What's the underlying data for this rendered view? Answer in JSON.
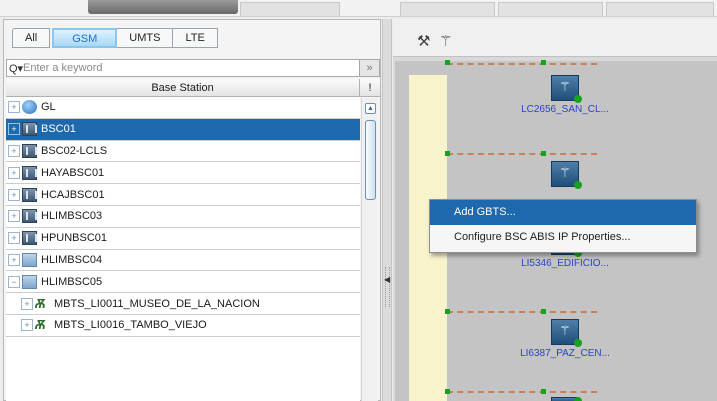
{
  "tabs": [
    {
      "label": "All",
      "active": false
    },
    {
      "label": "GSM",
      "active": true
    },
    {
      "label": "UMTS",
      "active": false
    },
    {
      "label": "LTE",
      "active": false
    }
  ],
  "search": {
    "placeholder": "Enter a keyword",
    "icon": "magnifier-dropdown-icon",
    "collapse_label": "»"
  },
  "table": {
    "header_base_station": "Base Station",
    "header_flag": "!",
    "rows": [
      {
        "label": "GL",
        "icon": "globe-icon",
        "selected": false,
        "child": false
      },
      {
        "label": "BSC01",
        "icon": "bsc-icon",
        "selected": true,
        "child": false
      },
      {
        "label": "BSC02-LCLS",
        "icon": "bsc-icon",
        "selected": false,
        "child": false
      },
      {
        "label": "HAYABSC01",
        "icon": "bsc-icon",
        "selected": false,
        "child": false
      },
      {
        "label": "HCAJBSC01",
        "icon": "bsc-icon",
        "selected": false,
        "child": false
      },
      {
        "label": "HLIMBSC03",
        "icon": "bsc-icon",
        "selected": false,
        "child": false
      },
      {
        "label": "HPUNBSC01",
        "icon": "bsc-icon",
        "selected": false,
        "child": false
      },
      {
        "label": "HLIMBSC04",
        "icon": "bsc-icon",
        "selected": false,
        "child": false
      },
      {
        "label": "HLIMBSC05",
        "icon": "bsc-light-icon",
        "selected": false,
        "child": false
      },
      {
        "label": "MBTS_LI0011_MUSEO_DE_LA_NACION",
        "icon": "mbts-icon",
        "selected": false,
        "child": true
      },
      {
        "label": "MBTS_LI0016_TAMBO_VIEJO",
        "icon": "mbts-icon",
        "selected": false,
        "child": true
      }
    ]
  },
  "toolbar": {
    "icons": [
      "wrench-person-icon",
      "antenna-person-icon"
    ]
  },
  "canvas": {
    "sites": [
      {
        "label": "LC2656_SAN_CL..."
      },
      {
        "label": ""
      },
      {
        "label": "LI5346_EDIFICIO..."
      },
      {
        "label": "LI6387_PAZ_CEN..."
      }
    ]
  },
  "context_menu": {
    "items": [
      {
        "label": "Add GBTS...",
        "highlighted": true
      },
      {
        "label": "Configure BSC ABIS IP Properties...",
        "highlighted": false
      }
    ]
  },
  "colors": {
    "selection": "#1e69ad",
    "link_label": "#2c42c6",
    "status_green": "#17a21e",
    "link_dash": "#c6805a",
    "canvas_bg": "#c4c4c4"
  }
}
